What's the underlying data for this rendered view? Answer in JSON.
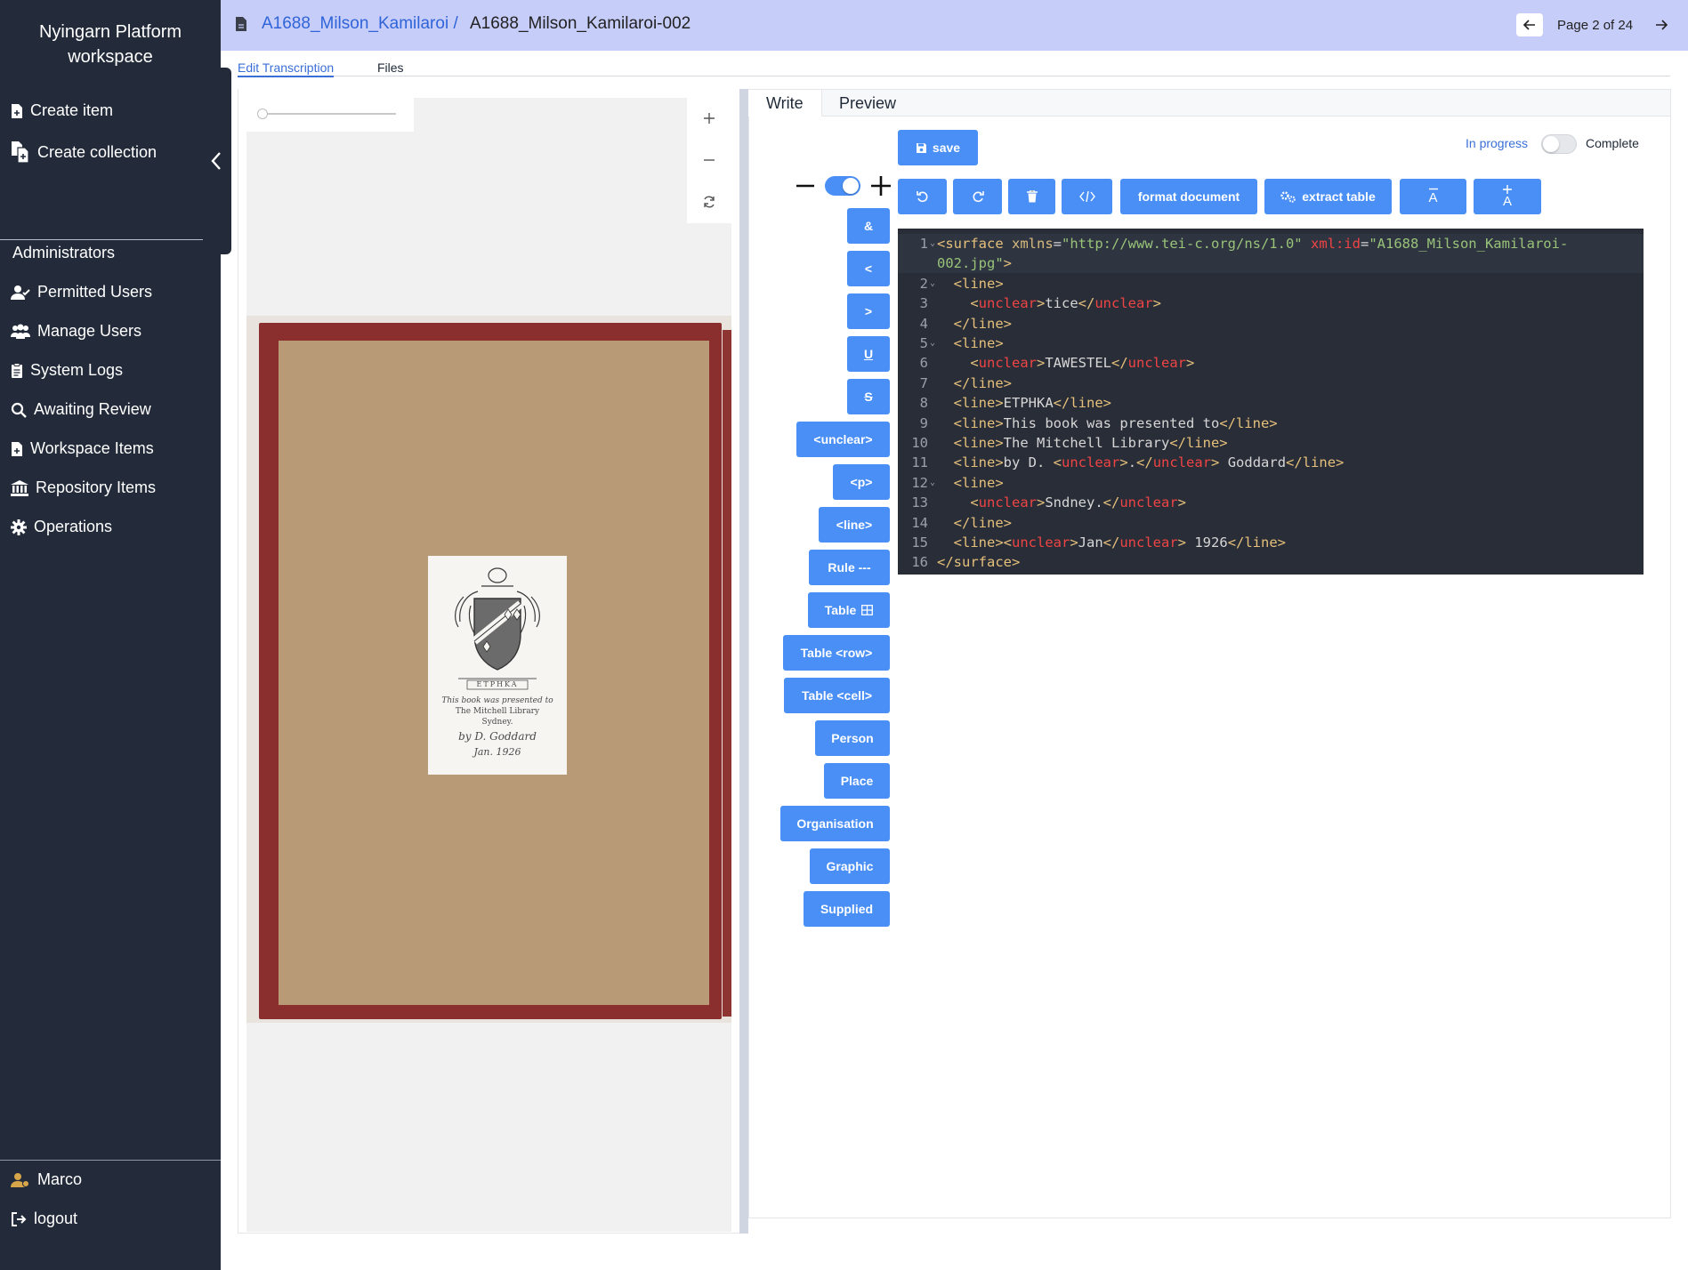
{
  "sidebar": {
    "title": "Nyingarn Platform workspace",
    "create_item": "Create item",
    "create_collection": "Create collection",
    "admin_heading": "Administrators",
    "items": [
      {
        "label": "Permitted Users"
      },
      {
        "label": "Manage Users"
      },
      {
        "label": "System Logs"
      },
      {
        "label": "Awaiting Review"
      },
      {
        "label": "Workspace Items"
      },
      {
        "label": "Repository Items"
      },
      {
        "label": "Operations"
      }
    ],
    "user_name": "Marco",
    "logout": "logout"
  },
  "header": {
    "collection_link": "A1688_Milson_Kamilaroi /",
    "current_item": "A1688_Milson_Kamilaroi-002",
    "page_indicator": "Page 2 of 24"
  },
  "tabs": {
    "edit": "Edit Transcription",
    "files": "Files"
  },
  "editor": {
    "tab_write": "Write",
    "tab_preview": "Preview",
    "save": "save",
    "status_in_progress": "In progress",
    "status_complete": "Complete",
    "format_document": "format document",
    "extract_table": "extract table",
    "font_decrease": "A",
    "font_increase": "A"
  },
  "markup_buttons": [
    {
      "label": "&"
    },
    {
      "label": "<"
    },
    {
      "label": ">"
    },
    {
      "label": "U"
    },
    {
      "label": "S"
    },
    {
      "label": "<unclear>"
    },
    {
      "label": "<p>"
    },
    {
      "label": "<line>"
    },
    {
      "label": "Rule ---"
    },
    {
      "label": "Table"
    },
    {
      "label": "Table <row>"
    },
    {
      "label": "Table <cell>"
    },
    {
      "label": "Person"
    },
    {
      "label": "Place"
    },
    {
      "label": "Organisation"
    },
    {
      "label": "Graphic"
    },
    {
      "label": "Supplied"
    }
  ],
  "bookplate": {
    "motto": "ETPHKA",
    "line1": "This book was presented to",
    "line2": "The Mitchell Library",
    "line3": "Sydney.",
    "line4": "by D. Goddard",
    "line5": "Jan. 1926"
  },
  "code_lines": [
    {
      "n": "1",
      "fold": true,
      "segs": [
        [
          "tk-tag",
          "<surface "
        ],
        [
          "tk-attr",
          "xmlns"
        ],
        [
          "tk-txt",
          "="
        ],
        [
          "tk-str",
          "\"http://www.tei-c.org/ns/1.0\""
        ],
        [
          "tk-txt",
          " "
        ],
        [
          "tk-red",
          "xml:id"
        ],
        [
          "tk-txt",
          "="
        ],
        [
          "tk-str",
          "\"A1688_Milson_Kamilaroi-"
        ]
      ]
    },
    {
      "n": "",
      "fold": false,
      "segs": [
        [
          "tk-str",
          "002.jpg\""
        ],
        [
          "tk-tag",
          ">"
        ]
      ]
    },
    {
      "n": "2",
      "fold": true,
      "segs": [
        [
          "tk-txt",
          "  "
        ],
        [
          "tk-tag",
          "<line>"
        ]
      ]
    },
    {
      "n": "3",
      "fold": false,
      "segs": [
        [
          "tk-txt",
          "    "
        ],
        [
          "tk-tag",
          "<"
        ],
        [
          "tk-red",
          "unclear"
        ],
        [
          "tk-tag",
          ">"
        ],
        [
          "tk-txt",
          "tice"
        ],
        [
          "tk-tag",
          "</"
        ],
        [
          "tk-red",
          "unclear"
        ],
        [
          "tk-tag",
          ">"
        ]
      ]
    },
    {
      "n": "4",
      "fold": false,
      "segs": [
        [
          "tk-txt",
          "  "
        ],
        [
          "tk-tag",
          "</line>"
        ]
      ]
    },
    {
      "n": "5",
      "fold": true,
      "segs": [
        [
          "tk-txt",
          "  "
        ],
        [
          "tk-tag",
          "<line>"
        ]
      ]
    },
    {
      "n": "6",
      "fold": false,
      "segs": [
        [
          "tk-txt",
          "    "
        ],
        [
          "tk-tag",
          "<"
        ],
        [
          "tk-red",
          "unclear"
        ],
        [
          "tk-tag",
          ">"
        ],
        [
          "tk-txt",
          "TAWESTEL"
        ],
        [
          "tk-tag",
          "</"
        ],
        [
          "tk-red",
          "unclear"
        ],
        [
          "tk-tag",
          ">"
        ]
      ]
    },
    {
      "n": "7",
      "fold": false,
      "segs": [
        [
          "tk-txt",
          "  "
        ],
        [
          "tk-tag",
          "</line>"
        ]
      ]
    },
    {
      "n": "8",
      "fold": false,
      "segs": [
        [
          "tk-txt",
          "  "
        ],
        [
          "tk-tag",
          "<line>"
        ],
        [
          "tk-txt",
          "ETPHKA"
        ],
        [
          "tk-tag",
          "</line>"
        ]
      ]
    },
    {
      "n": "9",
      "fold": false,
      "segs": [
        [
          "tk-txt",
          "  "
        ],
        [
          "tk-tag",
          "<line>"
        ],
        [
          "tk-txt",
          "This book was presented to"
        ],
        [
          "tk-tag",
          "</line>"
        ]
      ]
    },
    {
      "n": "10",
      "fold": false,
      "segs": [
        [
          "tk-txt",
          "  "
        ],
        [
          "tk-tag",
          "<line>"
        ],
        [
          "tk-txt",
          "The Mitchell Library"
        ],
        [
          "tk-tag",
          "</line>"
        ]
      ]
    },
    {
      "n": "11",
      "fold": false,
      "segs": [
        [
          "tk-txt",
          "  "
        ],
        [
          "tk-tag",
          "<line>"
        ],
        [
          "tk-txt",
          "by D. "
        ],
        [
          "tk-tag",
          "<"
        ],
        [
          "tk-red",
          "unclear"
        ],
        [
          "tk-tag",
          ">"
        ],
        [
          "tk-txt",
          "."
        ],
        [
          "tk-tag",
          "</"
        ],
        [
          "tk-red",
          "unclear"
        ],
        [
          "tk-tag",
          ">"
        ],
        [
          "tk-txt",
          " Goddard"
        ],
        [
          "tk-tag",
          "</line>"
        ]
      ]
    },
    {
      "n": "12",
      "fold": true,
      "segs": [
        [
          "tk-txt",
          "  "
        ],
        [
          "tk-tag",
          "<line>"
        ]
      ]
    },
    {
      "n": "13",
      "fold": false,
      "segs": [
        [
          "tk-txt",
          "    "
        ],
        [
          "tk-tag",
          "<"
        ],
        [
          "tk-red",
          "unclear"
        ],
        [
          "tk-tag",
          ">"
        ],
        [
          "tk-txt",
          "Sndney."
        ],
        [
          "tk-tag",
          "</"
        ],
        [
          "tk-red",
          "unclear"
        ],
        [
          "tk-tag",
          ">"
        ]
      ]
    },
    {
      "n": "14",
      "fold": false,
      "segs": [
        [
          "tk-txt",
          "  "
        ],
        [
          "tk-tag",
          "</line>"
        ]
      ]
    },
    {
      "n": "15",
      "fold": false,
      "segs": [
        [
          "tk-txt",
          "  "
        ],
        [
          "tk-tag",
          "<line><"
        ],
        [
          "tk-red",
          "unclear"
        ],
        [
          "tk-tag",
          ">"
        ],
        [
          "tk-txt",
          "Jan"
        ],
        [
          "tk-tag",
          "</"
        ],
        [
          "tk-red",
          "unclear"
        ],
        [
          "tk-tag",
          ">"
        ],
        [
          "tk-txt",
          " 1926"
        ],
        [
          "tk-tag",
          "</line>"
        ]
      ]
    },
    {
      "n": "16",
      "fold": false,
      "segs": [
        [
          "tk-tag",
          "</surface>"
        ]
      ]
    }
  ],
  "colors": {
    "sidebar_bg": "#232b3a",
    "header_bg": "#c7cdf9",
    "accent": "#4a8ff5",
    "link": "#2f64d8",
    "code_bg": "#292d37"
  }
}
